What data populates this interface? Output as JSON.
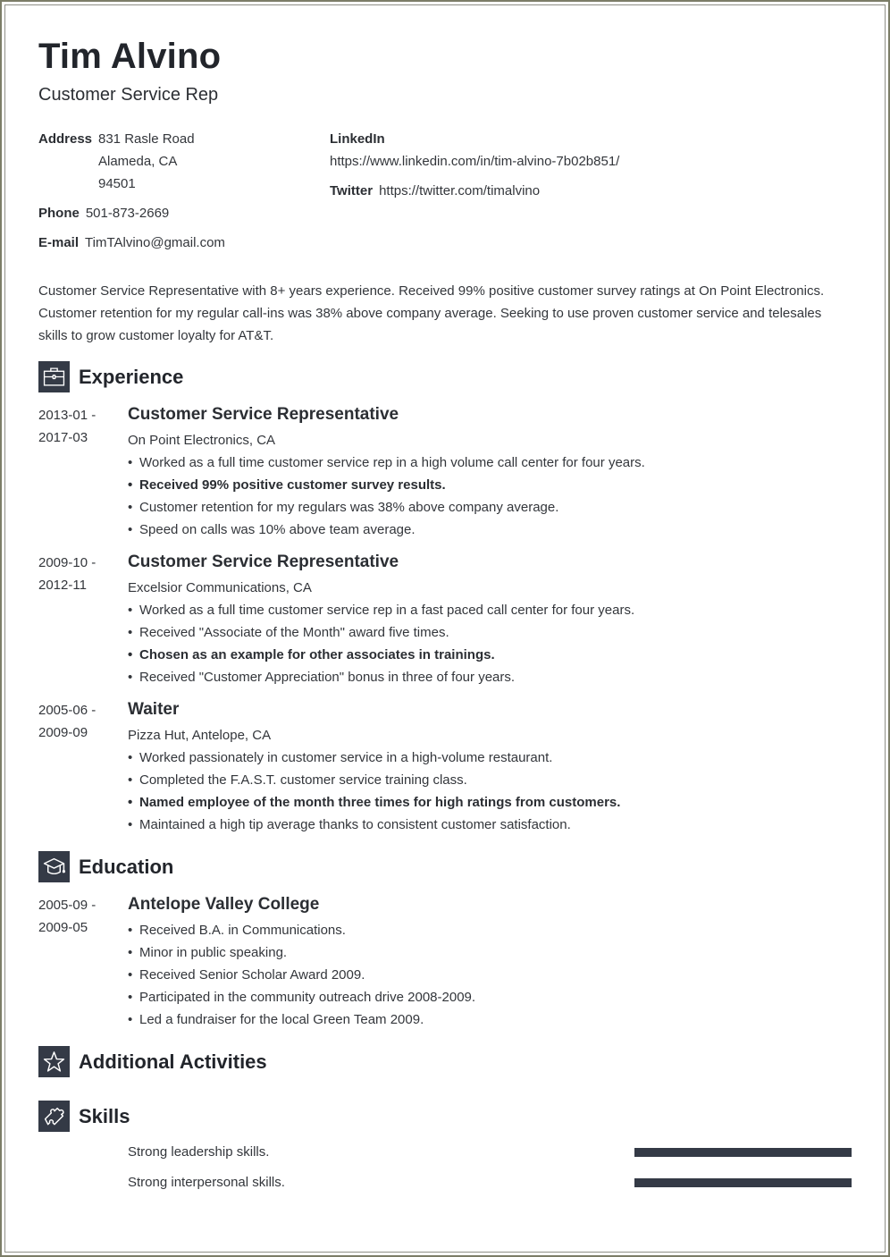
{
  "header": {
    "name": "Tim Alvino",
    "title": "Customer Service Rep"
  },
  "contact": {
    "address_label": "Address",
    "address_lines": [
      "831 Rasle Road",
      "Alameda, CA",
      "94501"
    ],
    "phone_label": "Phone",
    "phone": "501-873-2669",
    "email_label": "E-mail",
    "email": "TimTAlvino@gmail.com",
    "linkedin_label": "LinkedIn",
    "linkedin": "https://www.linkedin.com/in/tim-alvino-7b02b851/",
    "twitter_label": "Twitter",
    "twitter": "https://twitter.com/timalvino"
  },
  "summary": "Customer Service Representative with 8+ years experience. Received 99% positive customer survey ratings at On Point Electronics. Customer retention for my regular call-ins was 38% above company average. Seeking to use proven customer service and telesales skills to grow customer loyalty for AT&T.",
  "sections": {
    "experience": {
      "title": "Experience",
      "icon": "briefcase-icon"
    },
    "education": {
      "title": "Education",
      "icon": "graduation-cap-icon"
    },
    "activities": {
      "title": "Additional Activities",
      "icon": "star-icon"
    },
    "skills": {
      "title": "Skills",
      "icon": "puzzle-piece-icon"
    }
  },
  "experience": [
    {
      "date_start": "2013-01 -",
      "date_end": "2017-03",
      "title": "Customer Service Representative",
      "company": "On Point Electronics, CA",
      "bullets": [
        {
          "text": "Worked as a full time customer service rep in a high volume call center for four years.",
          "bold": false
        },
        {
          "text": "Received 99% positive customer survey results.",
          "bold": true
        },
        {
          "text": "Customer retention for my regulars was 38% above company average.",
          "bold": false
        },
        {
          "text": "Speed on calls was 10% above team average.",
          "bold": false
        }
      ]
    },
    {
      "date_start": "2009-10 -",
      "date_end": "2012-11",
      "title": "Customer Service Representative",
      "company": "Excelsior Communications, CA",
      "bullets": [
        {
          "text": "Worked as a full time customer service rep in a fast paced call center for four years.",
          "bold": false
        },
        {
          "text": "Received \"Associate of the Month\" award five times.",
          "bold": false
        },
        {
          "text": "Chosen as an example for other associates in trainings.",
          "bold": true
        },
        {
          "text": "Received \"Customer Appreciation\" bonus in three of four years.",
          "bold": false
        }
      ]
    },
    {
      "date_start": "2005-06 -",
      "date_end": "2009-09",
      "title": "Waiter",
      "company": "Pizza Hut, Antelope, CA",
      "bullets": [
        {
          "text": "Worked passionately in customer service in a high-volume restaurant.",
          "bold": false
        },
        {
          "text": "Completed the F.A.S.T. customer service training class.",
          "bold": false
        },
        {
          "text": "Named employee of the month three times for high ratings from customers.",
          "bold": true
        },
        {
          "text": "Maintained a high tip average thanks to consistent customer satisfaction.",
          "bold": false
        }
      ]
    }
  ],
  "education": [
    {
      "date_start": "2005-09 -",
      "date_end": "2009-05",
      "school": "Antelope Valley College",
      "bullets": [
        "Received B.A. in Communications.",
        "Minor in public speaking.",
        "Received Senior Scholar Award 2009.",
        "Participated in the community outreach drive 2008-2009.",
        "Led a fundraiser for the local Green Team 2009."
      ]
    }
  ],
  "skills": [
    {
      "name": "Strong leadership skills.",
      "level": 1.0
    },
    {
      "name": "Strong interpersonal skills.",
      "level": 1.0
    }
  ],
  "colors": {
    "accent": "#343a46",
    "text": "#2b2e33",
    "frame": "#7c7d68"
  }
}
